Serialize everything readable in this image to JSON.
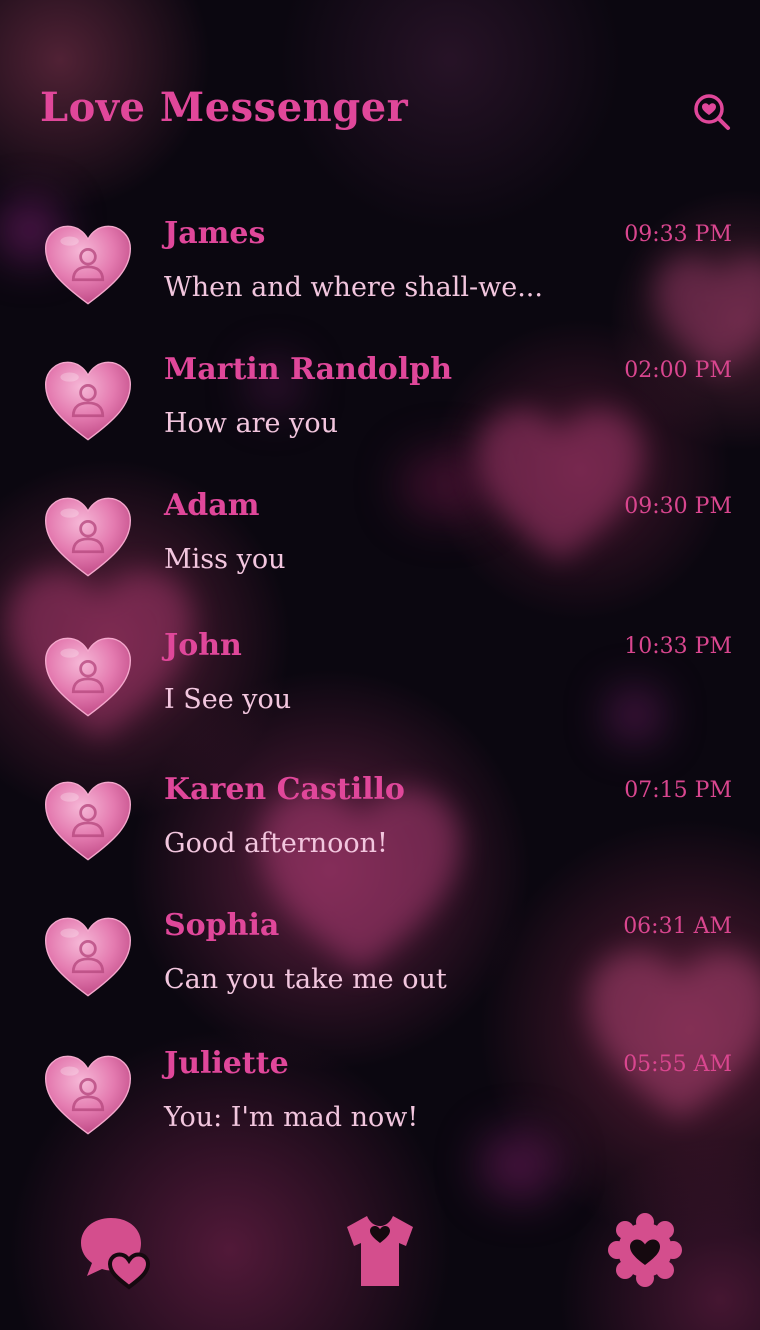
{
  "app": {
    "title": "Love Messenger"
  },
  "header": {
    "search_icon": "heart-search-icon"
  },
  "conversations": [
    {
      "name": "James",
      "preview": "When and where shall-we...",
      "time": "09:33 PM"
    },
    {
      "name": "Martin Randolph",
      "preview": "How are you",
      "time": "02:00 PM"
    },
    {
      "name": "Adam",
      "preview": "Miss you",
      "time": "09:30 PM"
    },
    {
      "name": "John",
      "preview": "I See you",
      "time": "10:33 PM"
    },
    {
      "name": "Karen Castillo",
      "preview": "Good afternoon!",
      "time": "07:15 PM"
    },
    {
      "name": "Sophia",
      "preview": "Can you take me out",
      "time": "06:31 AM"
    },
    {
      "name": "Juliette",
      "preview": "You: I'm mad now!",
      "time": "05:55 AM"
    }
  ],
  "bottom_nav": {
    "items": [
      {
        "icon": "chat-heart-icon"
      },
      {
        "icon": "shirt-heart-icon"
      },
      {
        "icon": "settings-heart-icon"
      }
    ]
  },
  "colors": {
    "accent": "#e0479a",
    "text_light": "#f2c6de",
    "nav_icon": "#d44e8d",
    "background": "#0b0710"
  }
}
